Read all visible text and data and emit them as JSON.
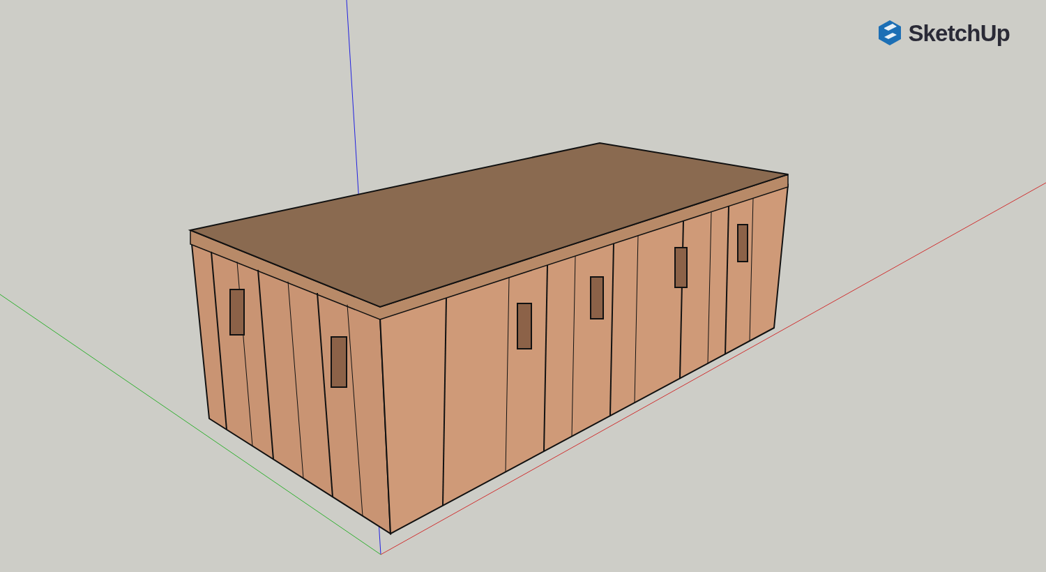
{
  "viewport": {
    "logo": {
      "text": "SketchUp"
    }
  }
}
